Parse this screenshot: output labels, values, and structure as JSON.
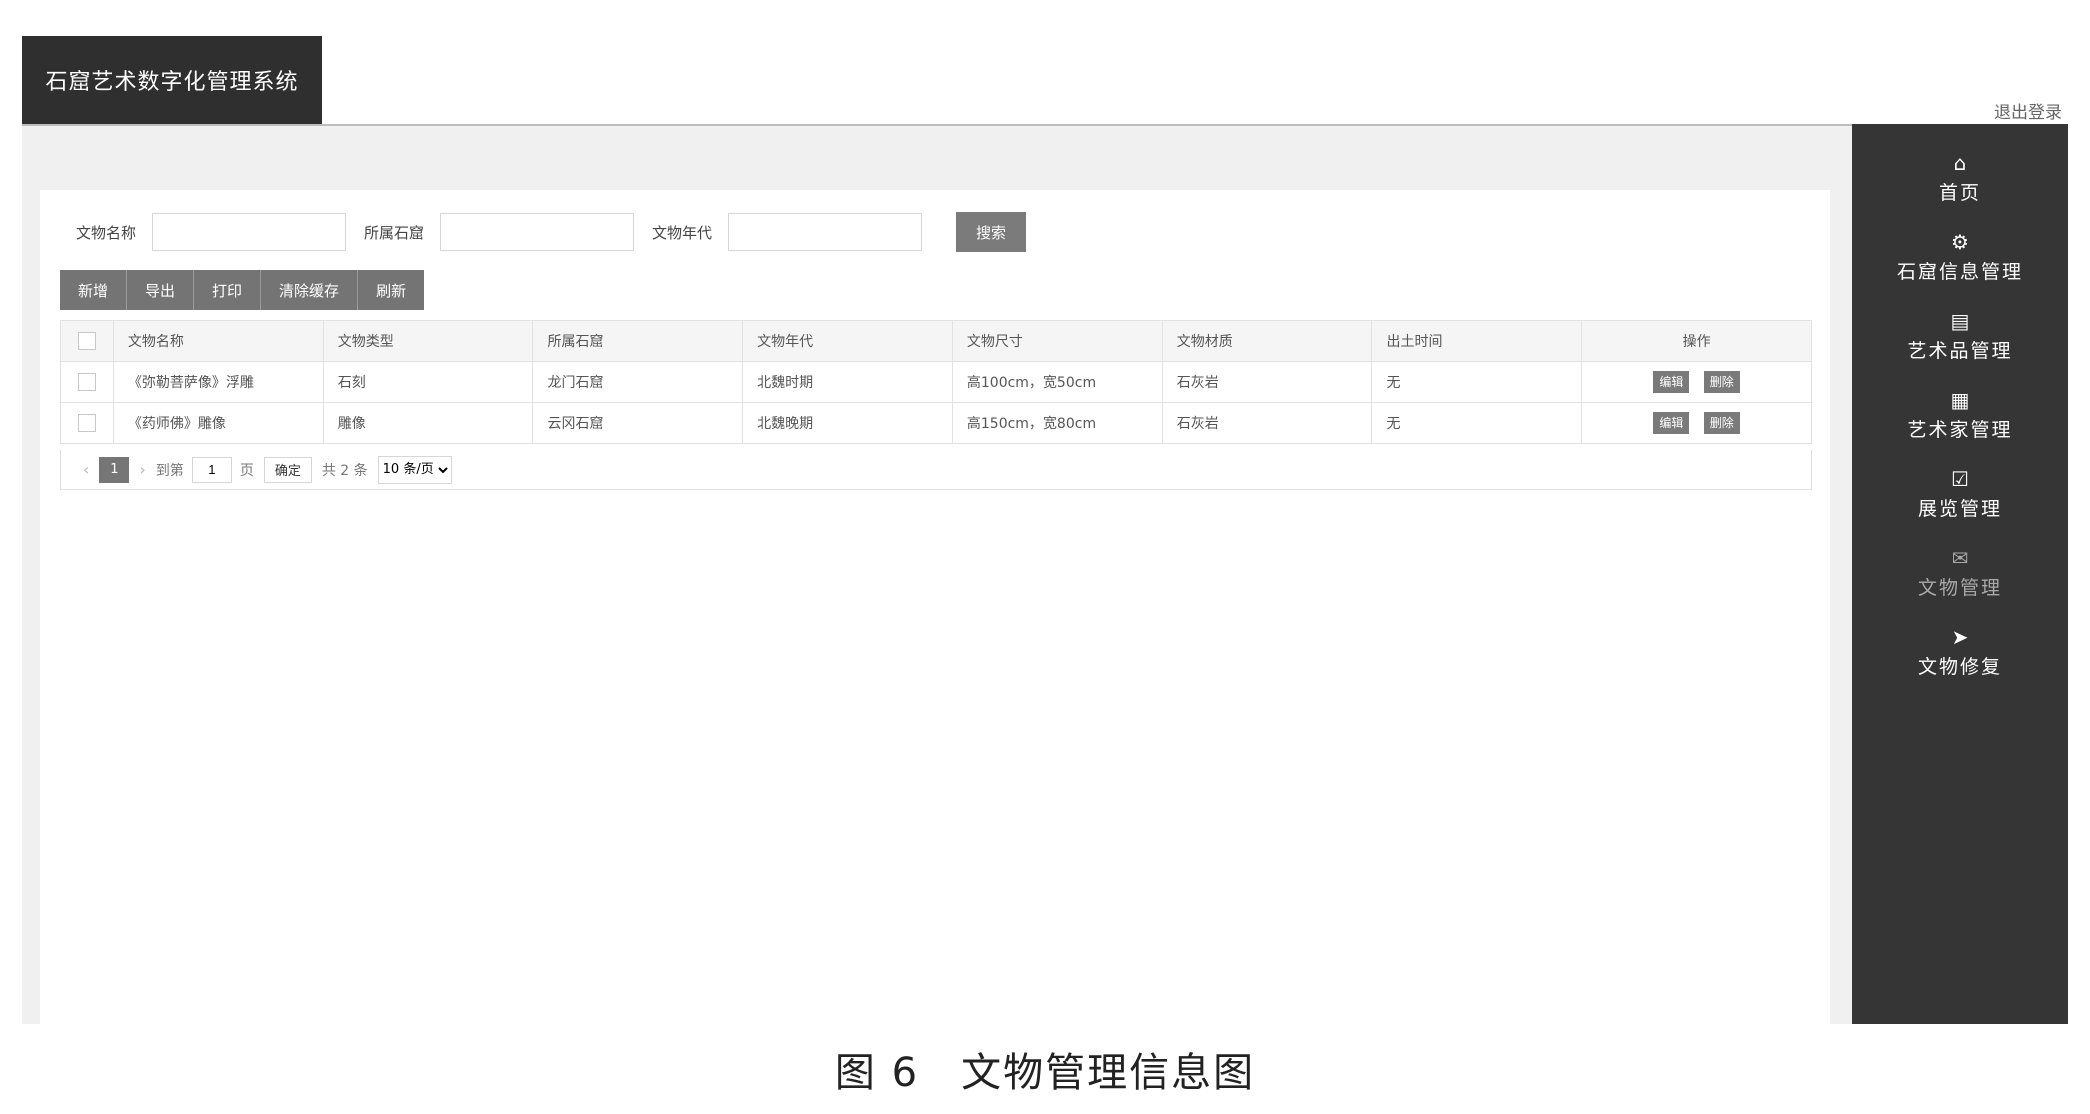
{
  "header": {
    "system_title": "石窟艺术数字化管理系统",
    "logout": "退出登录"
  },
  "search": {
    "fields": [
      {
        "label": "文物名称",
        "value": ""
      },
      {
        "label": "所属石窟",
        "value": ""
      },
      {
        "label": "文物年代",
        "value": ""
      }
    ],
    "button": "搜索"
  },
  "toolbar": {
    "add": "新增",
    "export": "导出",
    "print": "打印",
    "clear_cache": "清除缓存",
    "refresh": "刷新"
  },
  "table": {
    "columns": [
      "文物名称",
      "文物类型",
      "所属石窟",
      "文物年代",
      "文物尺寸",
      "文物材质",
      "出土时间",
      "操作"
    ],
    "rows": [
      [
        "《弥勒菩萨像》浮雕",
        "石刻",
        "龙门石窟",
        "北魏时期",
        "高100cm，宽50cm",
        "石灰岩",
        "无"
      ],
      [
        "《药师佛》雕像",
        "雕像",
        "云冈石窟",
        "北魏晚期",
        "高150cm，宽80cm",
        "石灰岩",
        "无"
      ]
    ],
    "edit_label": "编辑",
    "delete_label": "删除"
  },
  "pager": {
    "prev_icon": "‹",
    "next_icon": "›",
    "current": "1",
    "goto_label": "到第",
    "goto_value": "1",
    "page_unit": "页",
    "confirm": "确定",
    "total": "共 2 条",
    "page_size": "10 条/页"
  },
  "sidebar": {
    "items": [
      {
        "icon": "⌂",
        "label": "首页"
      },
      {
        "icon": "⚙",
        "label": "石窟信息管理"
      },
      {
        "icon": "▤",
        "label": "艺术品管理"
      },
      {
        "icon": "▦",
        "label": "艺术家管理"
      },
      {
        "icon": "☑",
        "label": "展览管理"
      },
      {
        "icon": "✉",
        "label": "文物管理"
      },
      {
        "icon": "➤",
        "label": "文物修复"
      }
    ]
  },
  "caption": "图 6　文物管理信息图"
}
